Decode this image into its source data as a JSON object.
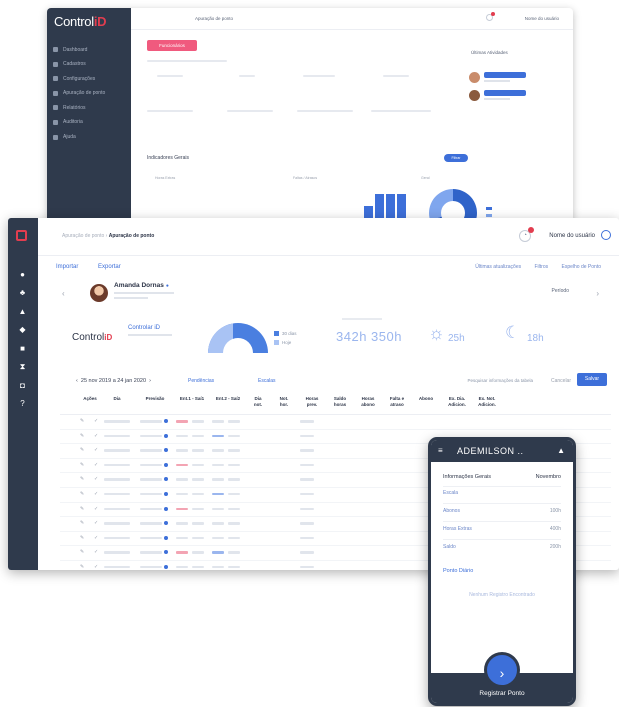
{
  "back_window": {
    "logo_text": "Control",
    "logo_id": "iD",
    "menu": [
      "Dashboard",
      "Cadastros",
      "Configurações",
      "Apuração de ponto",
      "Relatórios",
      "Auditoria",
      "Ajuda"
    ],
    "breadcrumb": "Apuração de ponto",
    "user": "Nome do usuário",
    "new_button": "Funcionários",
    "section_right": "Últimas Atividades",
    "section_bottom": "Indicadores Gerais",
    "filter_button": "Filtrar",
    "chart_labels": [
      "Horas Extras",
      "Faltas / Atrasos",
      "Geral"
    ],
    "bar_values": [
      0.15,
      0.55,
      0.95,
      0.95,
      0.95
    ]
  },
  "front_window": {
    "breadcrumb_prefix": "Apuração de ponto  ›",
    "breadcrumb_current": "Apuração de ponto",
    "user_name": "Nome do usuário",
    "actions": {
      "import": "Importar",
      "export": "Exportar"
    },
    "actions_right": [
      "Últimas atualizações",
      "Filtros",
      "Espelho de Ponto"
    ],
    "employee": {
      "name": "Amanda Dornas",
      "period_label": "Período"
    },
    "brand": {
      "text": "Control",
      "id": "iD",
      "device": "Controlar iD"
    },
    "gauge_legend": [
      "30 dias",
      "Hoje"
    ],
    "gauge_fraction": 0.6,
    "hours_total": "342h 350h",
    "day_hours": "25h",
    "night_hours": "18h",
    "date_range": "25 nov 2019 a 24 jan 2020",
    "filter_links": [
      "Pendências",
      "Escalas"
    ],
    "search_placeholder": "Pesquisar informações da tabela",
    "cancel_label": "Cancelar",
    "save_label": "Salvar",
    "columns": [
      "",
      "Ações",
      "Dia",
      "Previsão",
      "Ent.1 - Saí1",
      "Ent.2 - Saí2",
      "Dia\nnot.",
      "Not.\nhor.",
      "Horas\nprev.",
      "Saldo\nhoras",
      "Horas\nabono",
      "Falta e\natraso",
      "Abono",
      "Ex. Dia.\nAdicion.",
      "Ex. Not.\nAdicion."
    ],
    "row_count": 13
  },
  "phone": {
    "title": "ADEMILSON ..",
    "info_header": "Informações Gerais",
    "month": "Novembro",
    "rows": [
      {
        "label": "Escala",
        "value": ""
      },
      {
        "label": "Abonos",
        "value": "100h"
      },
      {
        "label": "Horas Extras",
        "value": "400h"
      },
      {
        "label": "Saldo",
        "value": "200h"
      }
    ],
    "ponto_label": "Ponto Diário",
    "empty_text": "Nenhum Registro Encontrado",
    "register_label": "Registrar Ponto"
  }
}
